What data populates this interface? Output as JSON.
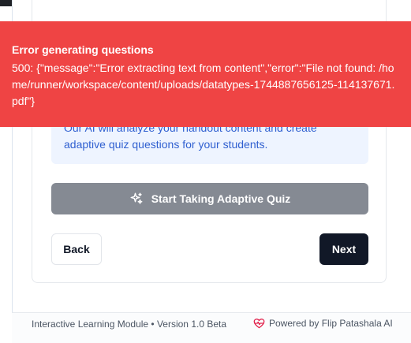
{
  "toast": {
    "title": "Error generating questions",
    "message": "500: {\"message\":\"Error extracting text from content\",\"error\":\"File not found: /home/runner/workspace/content/uploads/datatypes-1744887656125-114137671.pdf\"}"
  },
  "info": {
    "text": "Our AI will analyze your handout content and create adaptive quiz questions for your students."
  },
  "buttons": {
    "start_label": "Start Taking Adaptive Quiz",
    "start_icon": "sparkles-icon",
    "back_label": "Back",
    "next_label": "Next"
  },
  "footer": {
    "left_text": "Interactive Learning Module • Version 1.0 Beta",
    "right_text": "Powered by Flip Patashala AI",
    "right_icon": "heart-pulse-icon"
  },
  "colors": {
    "toast_bg": "#ef4444",
    "info_bg": "#eef4ff",
    "info_text": "#2f5fd0",
    "start_btn_bg": "#858a93",
    "next_btn_bg": "#111827",
    "heart": "#e11d48"
  }
}
